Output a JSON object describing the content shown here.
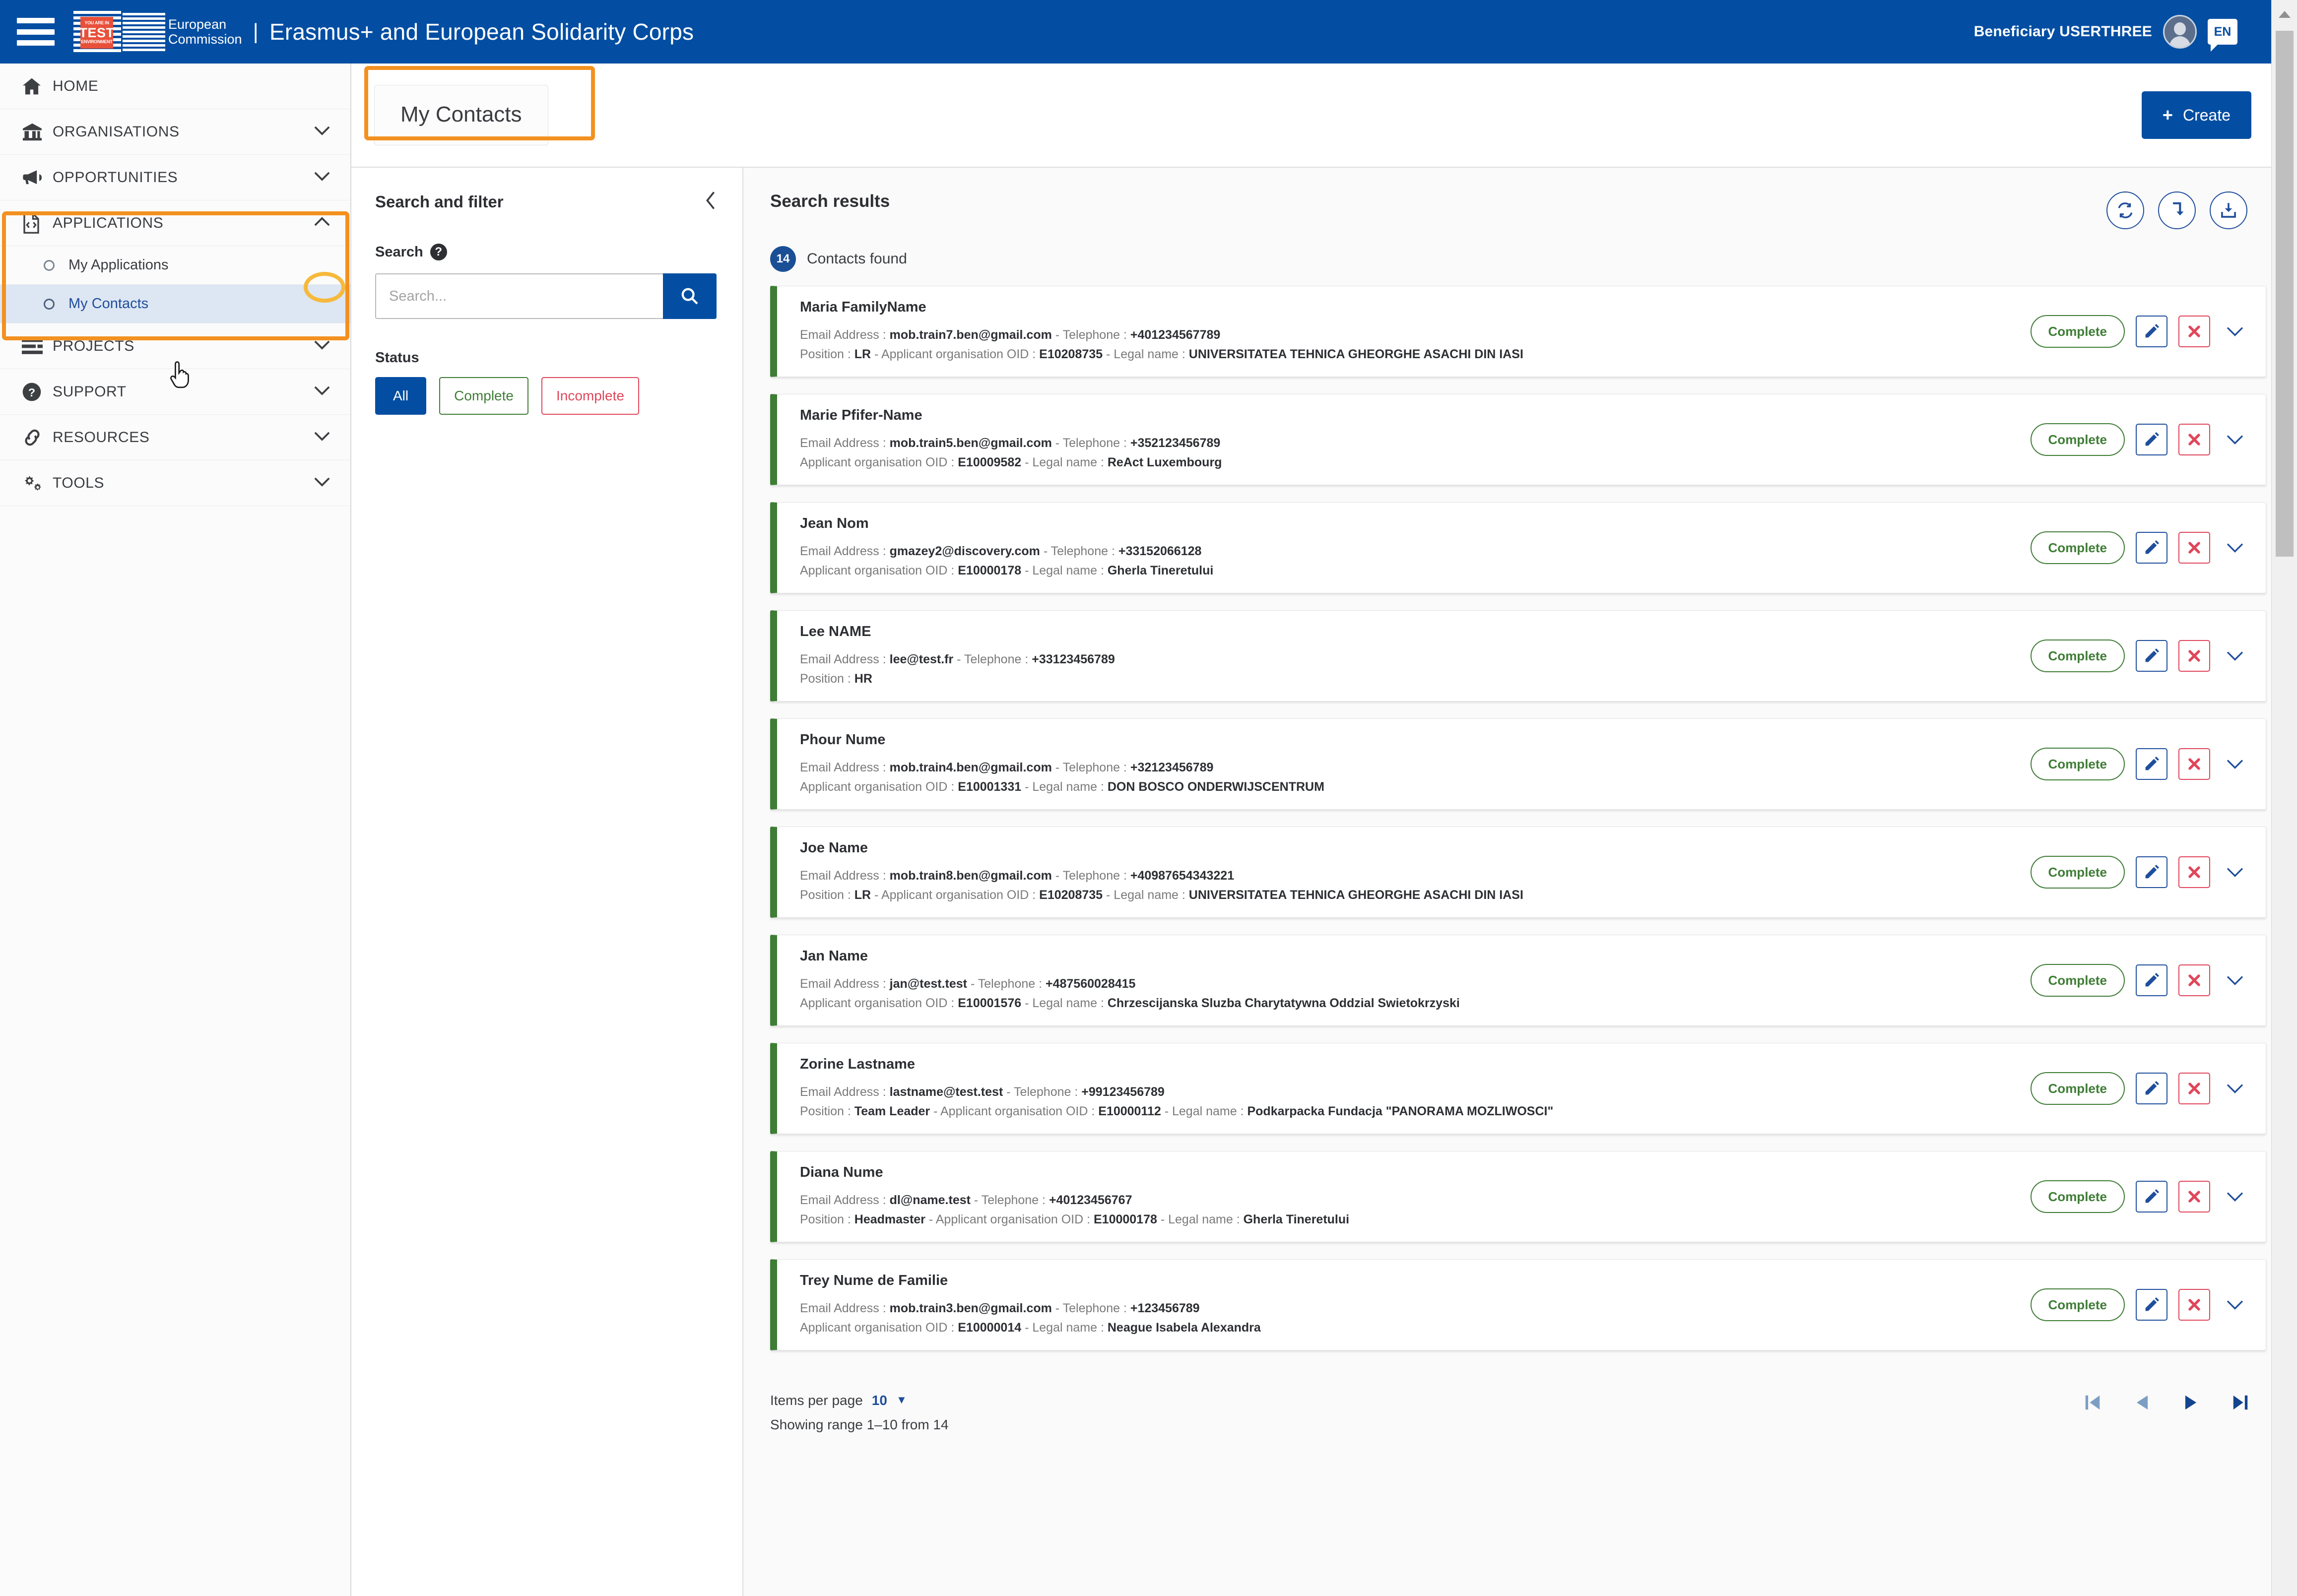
{
  "header": {
    "menu_icon": "hamburger-icon",
    "logo": {
      "test_line1": "YOU ARE IN",
      "test_big": "TEST",
      "test_line3": "ENVIRONMENT",
      "commission_line1": "European",
      "commission_line2": "Commission"
    },
    "app_title": "Erasmus+ and European Solidarity Corps",
    "user_name": "Beneficiary USERTHREE",
    "language": "EN"
  },
  "sidebar": {
    "items": [
      {
        "label": "HOME",
        "icon": "home-icon",
        "expandable": false
      },
      {
        "label": "ORGANISATIONS",
        "icon": "bank-icon",
        "expandable": true
      },
      {
        "label": "OPPORTUNITIES",
        "icon": "megaphone-icon",
        "expandable": true
      },
      {
        "label": "APPLICATIONS",
        "icon": "document-code-icon",
        "expandable": true,
        "expanded": true
      },
      {
        "label": "PROJECTS",
        "icon": "projects-list-icon",
        "expandable": true
      },
      {
        "label": "SUPPORT",
        "icon": "question-circle-icon",
        "expandable": true
      },
      {
        "label": "RESOURCES",
        "icon": "link-chain-icon",
        "expandable": true
      },
      {
        "label": "TOOLS",
        "icon": "gears-icon",
        "expandable": true
      }
    ],
    "applications_children": [
      {
        "label": "My Applications",
        "active": false
      },
      {
        "label": "My Contacts",
        "active": true
      }
    ]
  },
  "page": {
    "tab_title": "My Contacts",
    "create_label": "Create"
  },
  "filters": {
    "title": "Search and filter",
    "collapse_icon": "chevron-left-icon",
    "search_label": "Search",
    "search_value": "",
    "search_placeholder": "Search...",
    "status_label": "Status",
    "status_options": [
      {
        "label": "All",
        "state": "selected"
      },
      {
        "label": "Complete",
        "state": "complete"
      },
      {
        "label": "Incomplete",
        "state": "incomplete"
      }
    ]
  },
  "results": {
    "title": "Search results",
    "count": "14",
    "count_text": "Contacts found",
    "tools": [
      {
        "name": "refresh-icon"
      },
      {
        "name": "sort-down-icon"
      },
      {
        "name": "export-download-icon"
      }
    ],
    "action_labels": {
      "status_pill": "Complete",
      "edit": "edit-pencil-icon",
      "delete": "delete-x-icon",
      "expand": "chevron-down-icon"
    },
    "contacts": [
      {
        "name": "Maria FamilyName",
        "line1_prefix": "Email Address : ",
        "email": "mob.train7.ben@gmail.com",
        "tel_prefix": " - Telephone : ",
        "telephone": "+401234567789",
        "line2": [
          {
            "l": "Position : ",
            "v": "LR"
          },
          {
            "l": " - Applicant organisation OID : ",
            "v": "E10208735"
          },
          {
            "l": " - Legal name : ",
            "v": "UNIVERSITATEA TEHNICA GHEORGHE ASACHI DIN IASI"
          }
        ],
        "status": "Complete"
      },
      {
        "name": "Marie Pfifer-Name",
        "line1_prefix": "Email Address : ",
        "email": "mob.train5.ben@gmail.com",
        "tel_prefix": " - Telephone : ",
        "telephone": "+352123456789",
        "line2": [
          {
            "l": "Applicant organisation OID : ",
            "v": "E10009582"
          },
          {
            "l": " - Legal name : ",
            "v": "ReAct Luxembourg"
          }
        ],
        "status": "Complete"
      },
      {
        "name": "Jean Nom",
        "line1_prefix": "Email Address : ",
        "email": "gmazey2@discovery.com",
        "tel_prefix": " - Telephone : ",
        "telephone": "+33152066128",
        "line2": [
          {
            "l": "Applicant organisation OID : ",
            "v": "E10000178"
          },
          {
            "l": " - Legal name : ",
            "v": "Gherla Tineretului"
          }
        ],
        "status": "Complete"
      },
      {
        "name": "Lee NAME",
        "line1_prefix": "Email Address : ",
        "email": "lee@test.fr",
        "tel_prefix": " - Telephone : ",
        "telephone": "+33123456789",
        "line2": [
          {
            "l": "Position : ",
            "v": "HR"
          }
        ],
        "status": "Complete"
      },
      {
        "name": "Phour Nume",
        "line1_prefix": "Email Address : ",
        "email": "mob.train4.ben@gmail.com",
        "tel_prefix": " - Telephone : ",
        "telephone": "+32123456789",
        "line2": [
          {
            "l": "Applicant organisation OID : ",
            "v": "E10001331"
          },
          {
            "l": " - Legal name : ",
            "v": "DON BOSCO ONDERWIJSCENTRUM"
          }
        ],
        "status": "Complete"
      },
      {
        "name": "Joe Name",
        "line1_prefix": "Email Address : ",
        "email": "mob.train8.ben@gmail.com",
        "tel_prefix": " - Telephone : ",
        "telephone": "+40987654343221",
        "line2": [
          {
            "l": "Position : ",
            "v": "LR"
          },
          {
            "l": " - Applicant organisation OID : ",
            "v": "E10208735"
          },
          {
            "l": " - Legal name : ",
            "v": "UNIVERSITATEA TEHNICA GHEORGHE ASACHI DIN IASI"
          }
        ],
        "status": "Complete"
      },
      {
        "name": "Jan Name",
        "line1_prefix": "Email Address : ",
        "email": "jan@test.test",
        "tel_prefix": " - Telephone : ",
        "telephone": "+487560028415",
        "line2": [
          {
            "l": "Applicant organisation OID : ",
            "v": "E10001576"
          },
          {
            "l": " - Legal name : ",
            "v": "Chrzescijanska Sluzba Charytatywna Oddzial Swietokrzyski"
          }
        ],
        "status": "Complete"
      },
      {
        "name": "Zorine Lastname",
        "line1_prefix": "Email Address : ",
        "email": "lastname@test.test",
        "tel_prefix": " - Telephone : ",
        "telephone": "+99123456789",
        "line2": [
          {
            "l": "Position : ",
            "v": "Team Leader"
          },
          {
            "l": " - Applicant organisation OID : ",
            "v": "E10000112"
          },
          {
            "l": " - Legal name : ",
            "v": "Podkarpacka Fundacja \"PANORAMA MOZLIWOSCI\""
          }
        ],
        "status": "Complete"
      },
      {
        "name": "Diana Nume",
        "line1_prefix": "Email Address : ",
        "email": "dl@name.test",
        "tel_prefix": " - Telephone : ",
        "telephone": "+40123456767",
        "line2": [
          {
            "l": "Position : ",
            "v": "Headmaster"
          },
          {
            "l": " - Applicant organisation OID : ",
            "v": "E10000178"
          },
          {
            "l": " - Legal name : ",
            "v": "Gherla Tineretului"
          }
        ],
        "status": "Complete"
      },
      {
        "name": "Trey Nume de Familie",
        "line1_prefix": "Email Address : ",
        "email": "mob.train3.ben@gmail.com",
        "tel_prefix": " - Telephone : ",
        "telephone": "+123456789",
        "line2": [
          {
            "l": "Applicant organisation OID : ",
            "v": "E10000014"
          },
          {
            "l": " - Legal name : ",
            "v": "Neague Isabela Alexandra"
          }
        ],
        "status": "Complete"
      }
    ]
  },
  "pagination": {
    "items_per_page_label": "Items per page",
    "items_per_page_value": "10",
    "showing_range": "Showing range 1–10 from 14",
    "buttons": [
      "first-page-icon",
      "previous-page-icon",
      "next-page-icon",
      "last-page-icon"
    ]
  },
  "colors": {
    "brand_blue": "#034ea2",
    "accent_orange": "#f29120",
    "status_green": "#3f7d36",
    "status_red": "#e0465b"
  }
}
